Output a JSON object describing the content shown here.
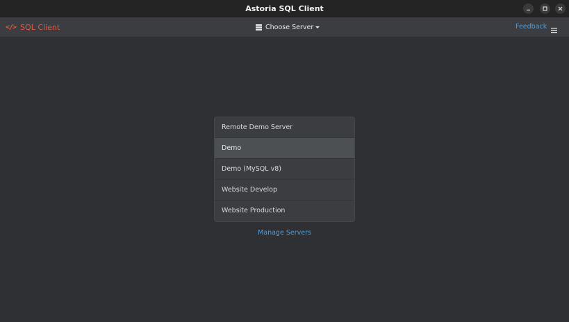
{
  "window": {
    "title": "Astoria SQL Client"
  },
  "toolbar": {
    "brand_label": "SQL Client",
    "brand_icon": "code-icon",
    "server_select_label": "Choose Server",
    "server_select_icon": "database-icon",
    "feedback_label": "Feedback",
    "menu_icon": "hamburger-menu-icon"
  },
  "servers": {
    "items": [
      {
        "label": "Remote Demo Server"
      },
      {
        "label": "Demo"
      },
      {
        "label": "Demo (MySQL v8)"
      },
      {
        "label": "Website Develop"
      },
      {
        "label": "Website Production"
      }
    ],
    "active_index": 1
  },
  "manage_servers_label": "Manage Servers",
  "colors": {
    "accent_brand": "#e5573e",
    "link": "#4d9fdc",
    "background": "#2f3033",
    "toolbar": "#3b3d40",
    "titlebar": "#242424"
  }
}
